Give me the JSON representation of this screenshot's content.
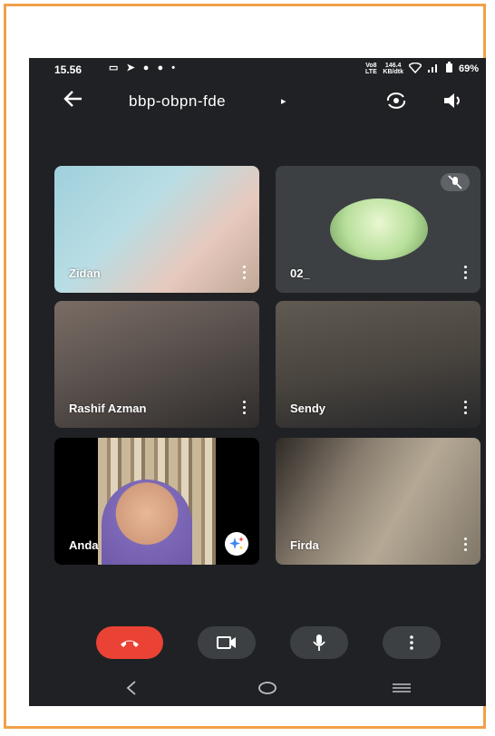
{
  "status_bar": {
    "time": "15.56",
    "left_icons": [
      "screen-record-icon",
      "send-icon",
      "app-icon",
      "app-icon",
      "notification-dot-icon"
    ],
    "network_label": "Vo8 LTE",
    "speed_value": "146.4",
    "speed_unit": "KB/dtk",
    "battery": "69%"
  },
  "header": {
    "meeting_code": "bbp-obpn-fde",
    "caret": "▸"
  },
  "participants": [
    {
      "name": "Zidan",
      "video": "on"
    },
    {
      "name": "02_",
      "video": "off",
      "muted": true
    },
    {
      "name": "Rashif Azman",
      "video": "on"
    },
    {
      "name": "Sendy",
      "video": "on"
    },
    {
      "name": "Anda",
      "video": "on"
    },
    {
      "name": "Firda",
      "video": "on"
    }
  ],
  "controls": [
    "end-call",
    "camera",
    "microphone",
    "more-options"
  ],
  "colors": {
    "background": "#202124",
    "end_call": "#ea4335",
    "control": "#3c4043",
    "frame": "#f0a04b"
  }
}
